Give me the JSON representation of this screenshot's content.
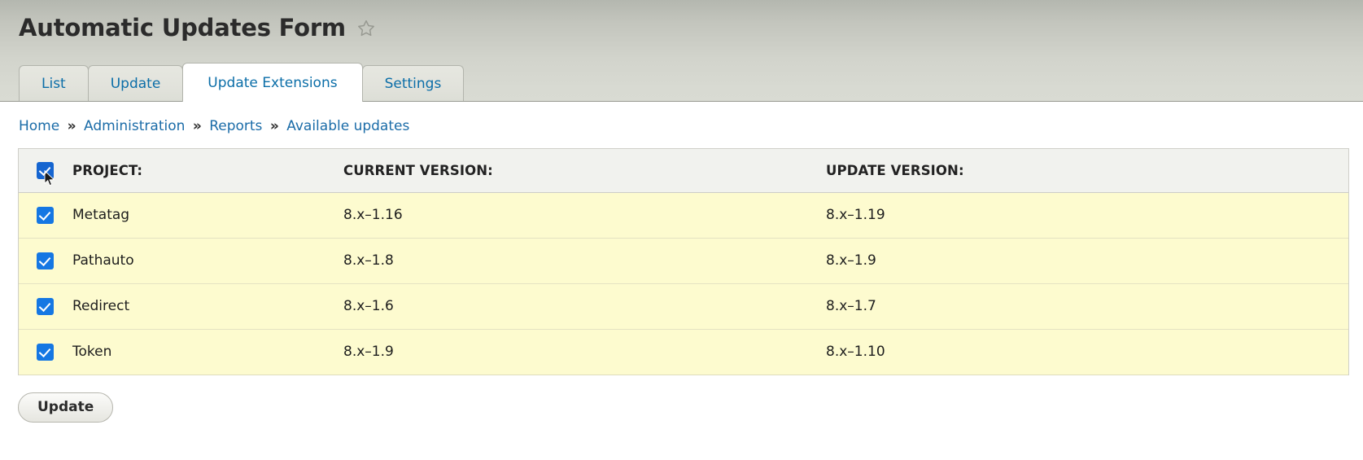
{
  "header": {
    "title": "Automatic Updates Form",
    "favorite_icon": "star-outline-icon",
    "tabs": [
      {
        "label": "List",
        "active": false
      },
      {
        "label": "Update",
        "active": false
      },
      {
        "label": "Update Extensions",
        "active": true
      },
      {
        "label": "Settings",
        "active": false
      }
    ]
  },
  "breadcrumb": {
    "separator": "»",
    "items": [
      {
        "label": "Home"
      },
      {
        "label": "Administration"
      },
      {
        "label": "Reports"
      },
      {
        "label": "Available updates"
      }
    ]
  },
  "table": {
    "select_all_checked": true,
    "columns": [
      {
        "key": "select",
        "label": ""
      },
      {
        "key": "project",
        "label": "PROJECT:"
      },
      {
        "key": "current_version",
        "label": "CURRENT VERSION:"
      },
      {
        "key": "update_version",
        "label": "UPDATE VERSION:"
      }
    ],
    "rows": [
      {
        "checked": true,
        "project": "Metatag",
        "current_version": "8.x–1.16",
        "update_version": "8.x–1.19"
      },
      {
        "checked": true,
        "project": "Pathauto",
        "current_version": "8.x–1.8",
        "update_version": "8.x–1.9"
      },
      {
        "checked": true,
        "project": "Redirect",
        "current_version": "8.x–1.6",
        "update_version": "8.x–1.7"
      },
      {
        "checked": true,
        "project": "Token",
        "current_version": "8.x–1.9",
        "update_version": "8.x–1.10"
      }
    ]
  },
  "actions": {
    "update_label": "Update"
  },
  "colors": {
    "link": "#1b6ca8",
    "tab_link": "#0b6ea8",
    "checkbox_blue": "#1577e3",
    "row_highlight": "#fdfbcf",
    "header_row": "#f1f2ee",
    "chrome_top": "#b4b7af",
    "chrome_bottom": "#d9dbd3"
  }
}
